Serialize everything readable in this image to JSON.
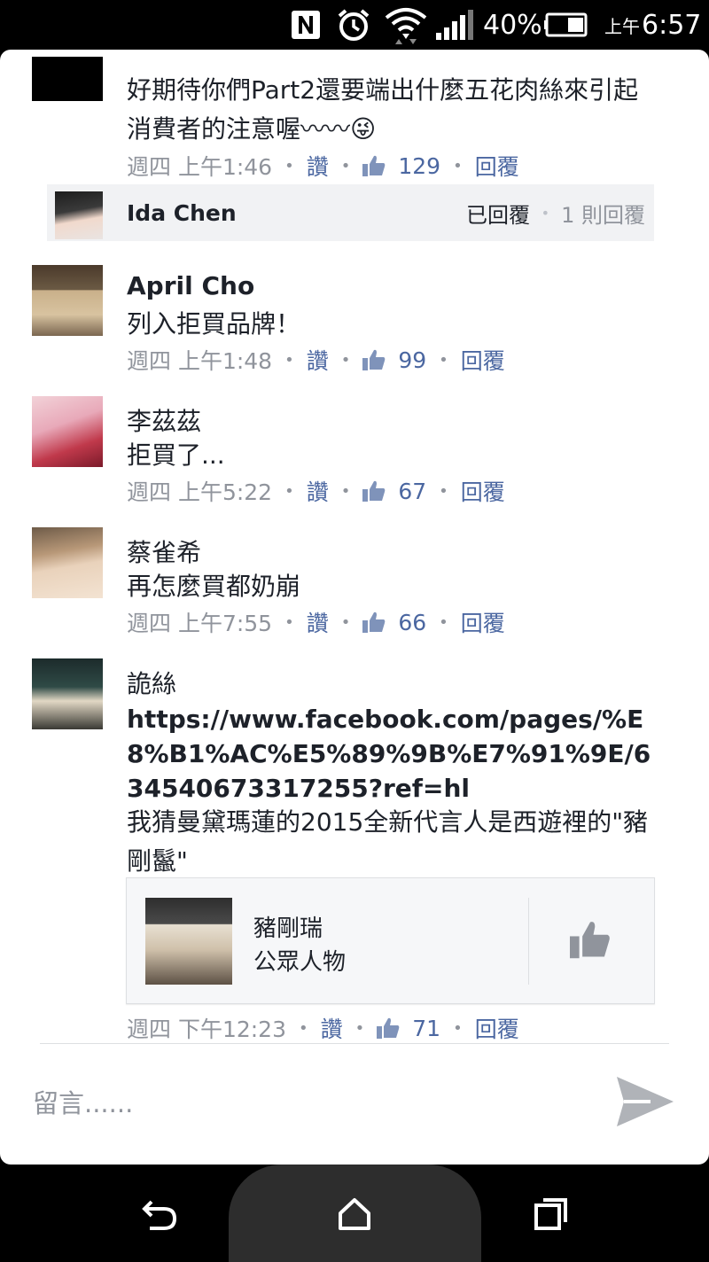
{
  "status_bar": {
    "nfc_icon": "nfc-icon",
    "alarm_icon": "alarm-icon",
    "battery_percent": "40%",
    "time_ampm": "上午",
    "time": "6:57"
  },
  "comments": [
    {
      "name": "",
      "text": "好期待你們Part2還要端出什麼五花肉絲來引起消費者的注意喔〰〰😜",
      "time": "週四 上午1:46",
      "like_label": "讚",
      "likes": "129",
      "reply_label": "回覆"
    },
    {
      "name": "April Cho",
      "text": "列入拒買品牌！",
      "time": "週四 上午1:48",
      "like_label": "讚",
      "likes": "99",
      "reply_label": "回覆"
    },
    {
      "name": "李茲茲",
      "text": "拒買了...",
      "time": "週四 上午5:22",
      "like_label": "讚",
      "likes": "67",
      "reply_label": "回覆"
    },
    {
      "name": "蔡雀希",
      "text": "再怎麼買都奶崩",
      "time": "週四 上午7:55",
      "like_label": "讚",
      "likes": "66",
      "reply_label": "回覆"
    },
    {
      "name": "詭絲",
      "link": "https://www.facebook.com/pages/%E8%B1%AC%E5%89%9B%E7%91%9E/634540673317255?ref=hl",
      "text": "我猜曼黛瑪蓮的2015全新代言人是西遊裡的\"豬剛鬣\"",
      "time": "週四 下午12:23",
      "like_label": "讚",
      "likes": "71",
      "reply_label": "回覆"
    }
  ],
  "reply_bar": {
    "name": "Ida Chen",
    "replied": "已回覆",
    "reply_count": "1 則回覆"
  },
  "shared_page": {
    "name": "豬剛瑞",
    "category": "公眾人物"
  },
  "composer": {
    "placeholder": "留言......"
  }
}
